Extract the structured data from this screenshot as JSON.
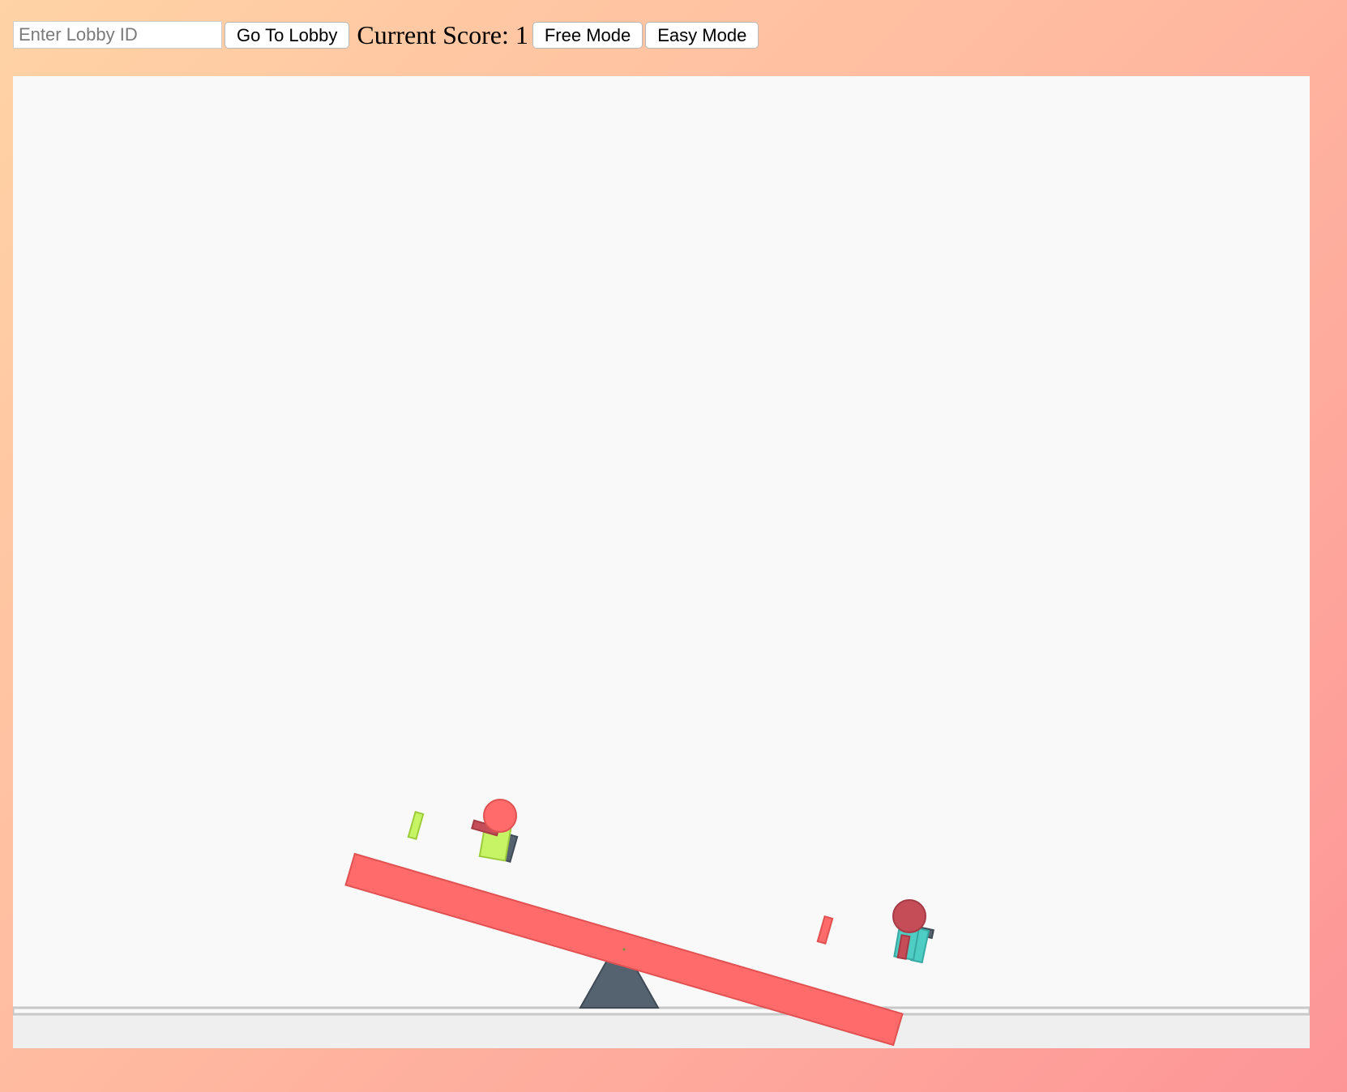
{
  "toolbar": {
    "lobby_input_placeholder": "Enter Lobby ID",
    "lobby_input_value": "",
    "go_to_lobby_label": "Go To Lobby",
    "score_label": "Current Score:",
    "score_value": "1",
    "free_mode_label": "Free Mode",
    "easy_mode_label": "Easy Mode"
  },
  "game": {
    "seesaw_tilt_direction": "right-side-down",
    "colors": {
      "background": "#f9f9fa",
      "ground": "#efefef",
      "ground_line": "#c8c8c8",
      "plank": "#ff6b6b",
      "plank_stroke": "#e05252",
      "fulcrum": "#556270",
      "player_left_body": "#c7f464",
      "player_left_head": "#ff6b6b",
      "player_right_body": "#4ecdc4",
      "player_right_head": "#c44d58",
      "weapon_dark": "#556270"
    }
  }
}
